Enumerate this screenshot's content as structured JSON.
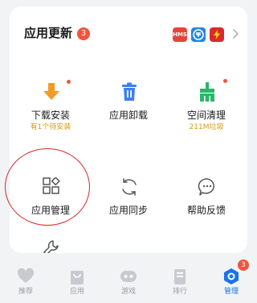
{
  "header": {
    "title": "应用更新",
    "update_count": "3",
    "app_icons": [
      {
        "name": "hms-icon",
        "text": "HMS",
        "color": "#e8433a"
      },
      {
        "name": "app-blue-icon",
        "text": "",
        "color": "#1e88e5"
      },
      {
        "name": "app-red-lightning-icon",
        "text": "",
        "color": "#d62b2b"
      }
    ]
  },
  "grid": {
    "items": [
      {
        "id": "download-install",
        "label": "下载安装",
        "sub": "有1个待安装",
        "has_dot": true
      },
      {
        "id": "app-uninstall",
        "label": "应用卸载",
        "sub": "",
        "has_dot": false
      },
      {
        "id": "space-clean",
        "label": "空间清理",
        "sub": "211M垃圾",
        "has_dot": true
      },
      {
        "id": "app-manage",
        "label": "应用管理",
        "sub": "",
        "has_dot": false
      },
      {
        "id": "app-sync",
        "label": "应用同步",
        "sub": "",
        "has_dot": false
      },
      {
        "id": "help-feedback",
        "label": "帮助反馈",
        "sub": "",
        "has_dot": false
      }
    ]
  },
  "tabbar": {
    "tabs": [
      {
        "id": "recommend",
        "label": "推荐",
        "active": false
      },
      {
        "id": "apps",
        "label": "应用",
        "active": false
      },
      {
        "id": "games",
        "label": "游戏",
        "active": false
      },
      {
        "id": "ranking",
        "label": "排行",
        "active": false
      },
      {
        "id": "manage",
        "label": "管理",
        "active": true,
        "badge": "3"
      }
    ]
  },
  "colors": {
    "accent": "#1a73e8",
    "badge": "#f0553f",
    "orange": "#f59a23",
    "blue": "#3d7ff5",
    "green": "#27b86a",
    "annotation": "#d42a2a"
  }
}
